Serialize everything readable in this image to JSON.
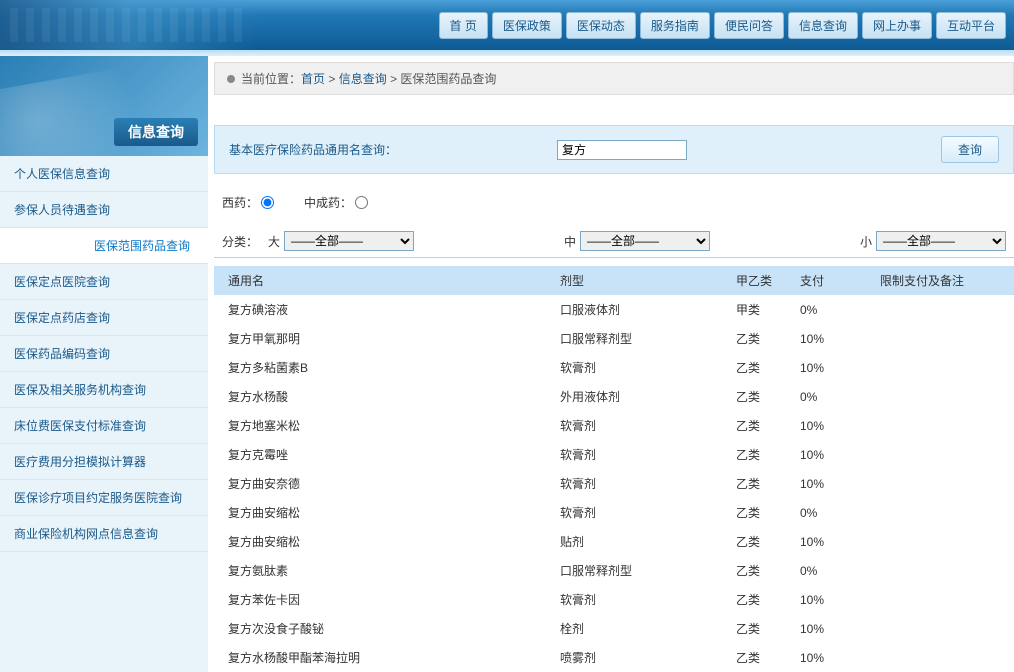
{
  "nav": [
    {
      "label": "首 页"
    },
    {
      "label": "医保政策"
    },
    {
      "label": "医保动态"
    },
    {
      "label": "服务指南"
    },
    {
      "label": "便民问答"
    },
    {
      "label": "信息查询"
    },
    {
      "label": "网上办事"
    },
    {
      "label": "互动平台"
    }
  ],
  "sidebar": {
    "hero_label": "信息查询",
    "items": [
      {
        "label": "个人医保信息查询"
      },
      {
        "label": "参保人员待遇查询"
      },
      {
        "label": "医保范围药品查询",
        "active": true
      },
      {
        "label": "医保定点医院查询"
      },
      {
        "label": "医保定点药店查询"
      },
      {
        "label": "医保药品编码查询"
      },
      {
        "label": "医保及相关服务机构查询"
      },
      {
        "label": "床位费医保支付标准查询"
      },
      {
        "label": "医疗费用分担模拟计算器"
      },
      {
        "label": "医保诊疗项目约定服务医院查询"
      },
      {
        "label": "商业保险机构网点信息查询"
      }
    ]
  },
  "breadcrumb": {
    "prefix": "当前位置：",
    "parts": [
      "首页",
      "信息查询",
      "医保范围药品查询"
    ],
    "sep": ">"
  },
  "search": {
    "label": "基本医疗保险药品通用名查询：",
    "value": "复方",
    "button": "查询"
  },
  "filter": {
    "type_row": {
      "western": "西药：",
      "chinese": "中成药："
    },
    "category_row": {
      "label": "分类：",
      "big": "大",
      "mid": "中",
      "small": "小",
      "option_all": "——全部——"
    }
  },
  "table": {
    "headers": {
      "name": "通用名",
      "form": "剂型",
      "type": "甲乙类",
      "pay": "支付",
      "note": "限制支付及备注"
    },
    "rows": [
      {
        "name": "复方碘溶液",
        "form": "口服液体剂",
        "type": "甲类",
        "pay": "0%",
        "note": ""
      },
      {
        "name": "复方甲氧那明",
        "form": "口服常释剂型",
        "type": "乙类",
        "pay": "10%",
        "note": ""
      },
      {
        "name": "复方多粘菌素B",
        "form": "软膏剂",
        "type": "乙类",
        "pay": "10%",
        "note": ""
      },
      {
        "name": "复方水杨酸",
        "form": "外用液体剂",
        "type": "乙类",
        "pay": "0%",
        "note": ""
      },
      {
        "name": "复方地塞米松",
        "form": "软膏剂",
        "type": "乙类",
        "pay": "10%",
        "note": ""
      },
      {
        "name": "复方克霉唑",
        "form": "软膏剂",
        "type": "乙类",
        "pay": "10%",
        "note": ""
      },
      {
        "name": "复方曲安奈德",
        "form": "软膏剂",
        "type": "乙类",
        "pay": "10%",
        "note": ""
      },
      {
        "name": "复方曲安缩松",
        "form": "软膏剂",
        "type": "乙类",
        "pay": "0%",
        "note": ""
      },
      {
        "name": "复方曲安缩松",
        "form": "贴剂",
        "type": "乙类",
        "pay": "10%",
        "note": ""
      },
      {
        "name": "复方氨肽素",
        "form": "口服常释剂型",
        "type": "乙类",
        "pay": "0%",
        "note": ""
      },
      {
        "name": "复方苯佐卡因",
        "form": "软膏剂",
        "type": "乙类",
        "pay": "10%",
        "note": ""
      },
      {
        "name": "复方次没食子酸铋",
        "form": "栓剂",
        "type": "乙类",
        "pay": "10%",
        "note": ""
      },
      {
        "name": "复方水杨酸甲酯苯海拉明",
        "form": "喷雾剂",
        "type": "乙类",
        "pay": "10%",
        "note": ""
      }
    ]
  }
}
